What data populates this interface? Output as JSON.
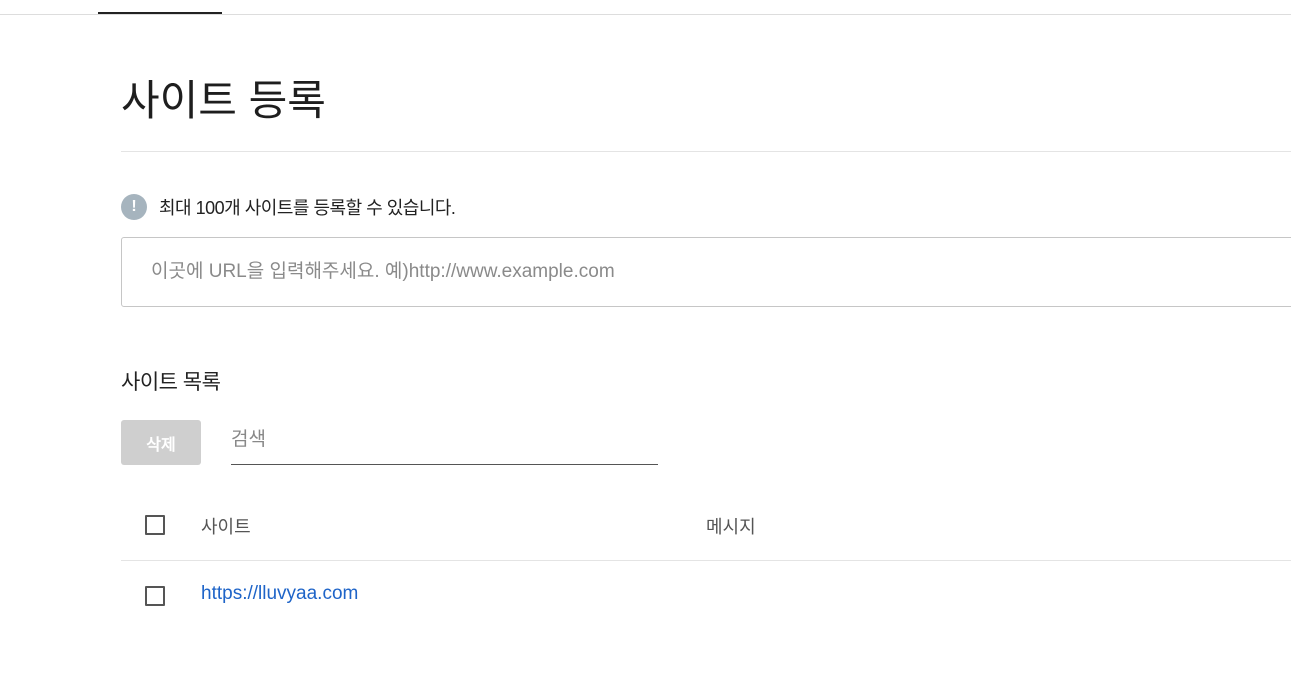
{
  "page": {
    "title": "사이트 등록"
  },
  "notice": {
    "icon": "exclamation-circle-icon",
    "text": "최대 100개 사이트를 등록할 수 있습니다."
  },
  "url_input": {
    "placeholder": "이곳에 URL을 입력해주세요. 예)http://www.example.com",
    "value": ""
  },
  "site_list": {
    "title": "사이트 목록",
    "delete_label": "삭제",
    "search_placeholder": "검색",
    "columns": {
      "site": "사이트",
      "message": "메시지"
    },
    "rows": [
      {
        "site": "https://lluvyaa.com",
        "message": "",
        "checked": false
      }
    ]
  },
  "colors": {
    "link": "#1e64c8",
    "disabled_button": "#cfcfcf",
    "notice_icon": "#a6b4be"
  }
}
